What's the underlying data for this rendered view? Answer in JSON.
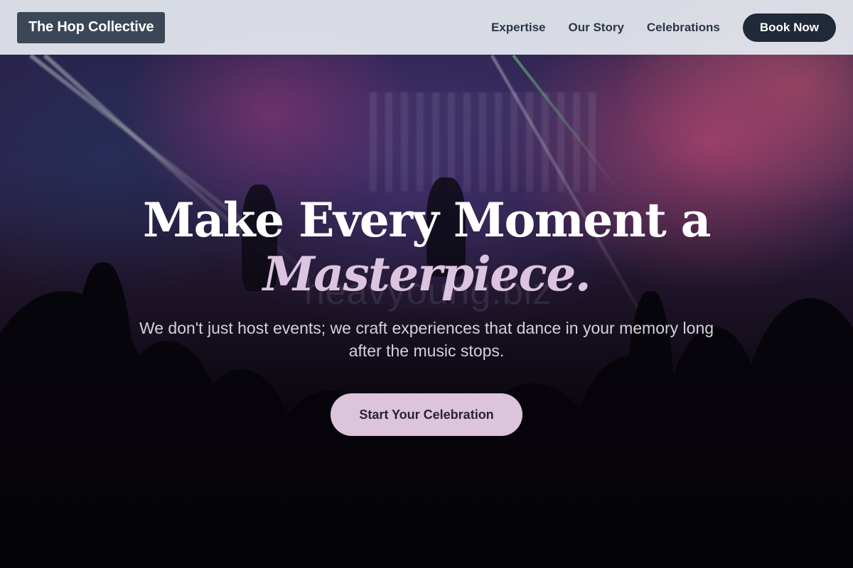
{
  "header": {
    "logo_text": "The Hop Collective",
    "nav": {
      "expertise": "Expertise",
      "our_story": "Our Story",
      "celebrations": "Celebrations"
    },
    "book_button": "Book Now"
  },
  "hero": {
    "headline_line1": "Make Every Moment a",
    "headline_accent": "Masterpiece.",
    "watermark": "heavyoung.biz",
    "subtext": "We don't just host events; we craft experiences that dance in your memory long after the music stops.",
    "cta_label": "Start Your Celebration"
  },
  "colors": {
    "header_bg": "#e5e9f0",
    "logo_bg": "#3b4656",
    "book_bg": "#1f2937",
    "accent": "#dcc4e0",
    "cta_bg": "#dcc4dc"
  }
}
